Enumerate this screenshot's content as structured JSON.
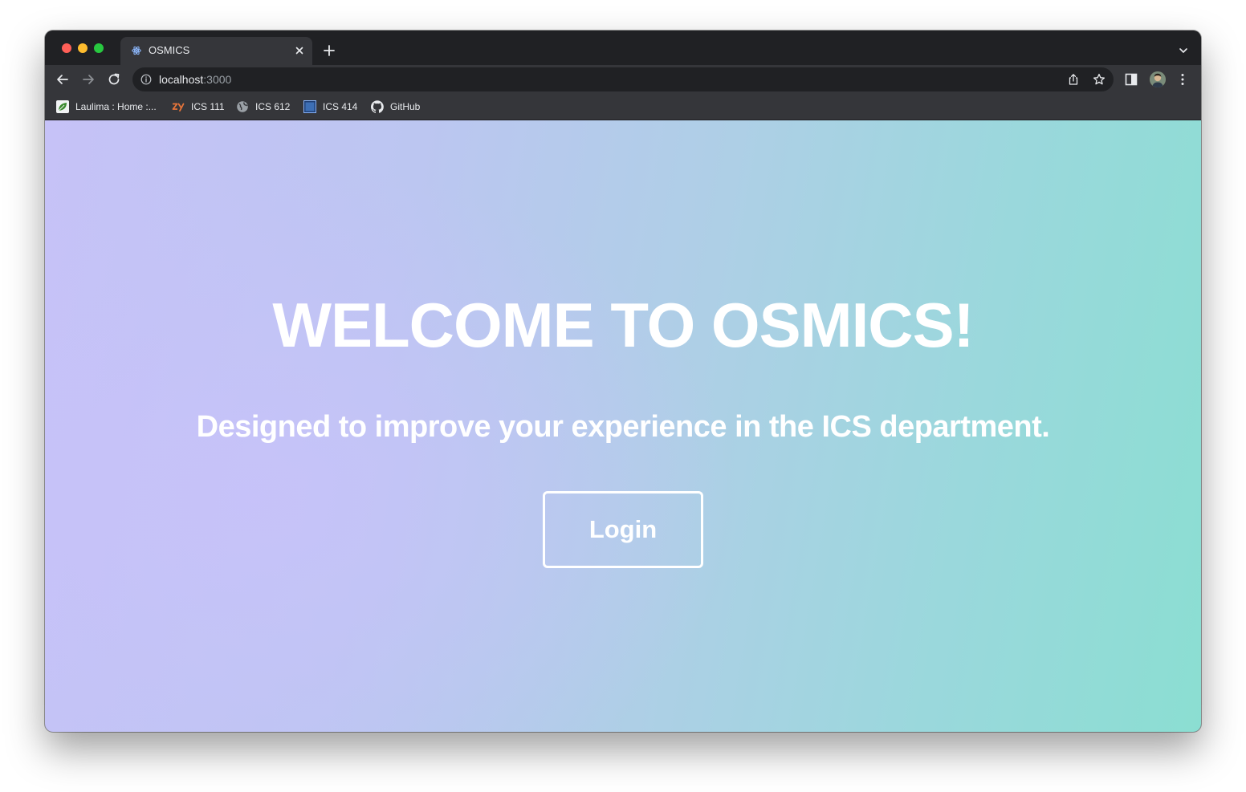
{
  "browser": {
    "tab": {
      "title": "OSMICS",
      "favicon": "react-logo-icon"
    },
    "omnibox": {
      "host": "localhost",
      "port": ":3000"
    },
    "bookmarks": [
      {
        "label": "Laulima : Home :...",
        "icon": "laulima-leaf-icon"
      },
      {
        "label": "ICS 111",
        "icon": "zybooks-icon"
      },
      {
        "label": "ICS 612",
        "icon": "globe-icon"
      },
      {
        "label": "ICS 414",
        "icon": "blue-square-icon"
      },
      {
        "label": "GitHub",
        "icon": "github-icon"
      }
    ]
  },
  "page": {
    "headline": "WELCOME TO OSMICS!",
    "subheadline": "Designed to improve your experience in the ICS department.",
    "login_label": "Login"
  },
  "colors": {
    "gradient_left": "#c6c2f7",
    "gradient_right": "#8bded2",
    "text": "#ffffff",
    "chrome_dark": "#202124",
    "chrome_toolbar": "#35363a"
  }
}
